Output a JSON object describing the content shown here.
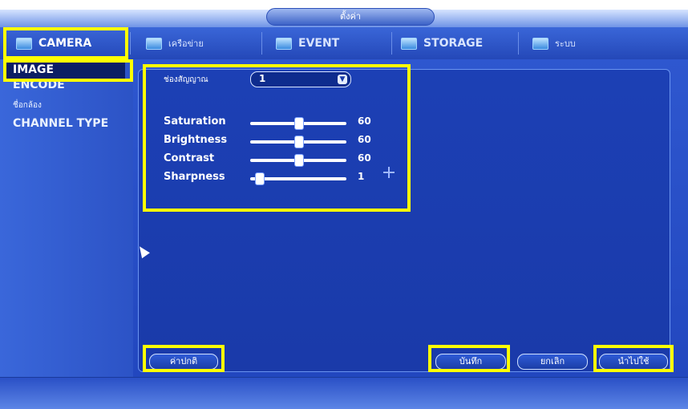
{
  "window": {
    "title": "ตั้งค่า"
  },
  "tabs": [
    {
      "label": "CAMERA",
      "icon": "camera-icon",
      "active": true
    },
    {
      "label": "เครือข่าย",
      "icon": "network-icon"
    },
    {
      "label": "EVENT",
      "icon": "event-icon"
    },
    {
      "label": "STORAGE",
      "icon": "storage-icon"
    },
    {
      "label": "ระบบ",
      "icon": "system-icon"
    }
  ],
  "sidebar": {
    "items": [
      {
        "label": "IMAGE",
        "active": true
      },
      {
        "label": "ENCODE"
      },
      {
        "label": "ชื่อกล้อง"
      },
      {
        "label": "CHANNEL TYPE"
      }
    ]
  },
  "image_settings": {
    "channel_label": "ช่องสัญญาณ",
    "channel_value": "1",
    "sliders": [
      {
        "label": "Saturation",
        "value": "60",
        "level": 0.5
      },
      {
        "label": "Brightness",
        "value": "60",
        "level": 0.5
      },
      {
        "label": "Contrast",
        "value": "60",
        "level": 0.5
      },
      {
        "label": "Sharpness",
        "value": "1",
        "level": 0.05
      }
    ]
  },
  "buttons": {
    "default": "ค่าปกติ",
    "save": "บันทึก",
    "cancel": "ยกเลิก",
    "apply": "นำไปใช้"
  },
  "colors": {
    "highlight": "#ffff00",
    "panel": "#1c40b5"
  }
}
